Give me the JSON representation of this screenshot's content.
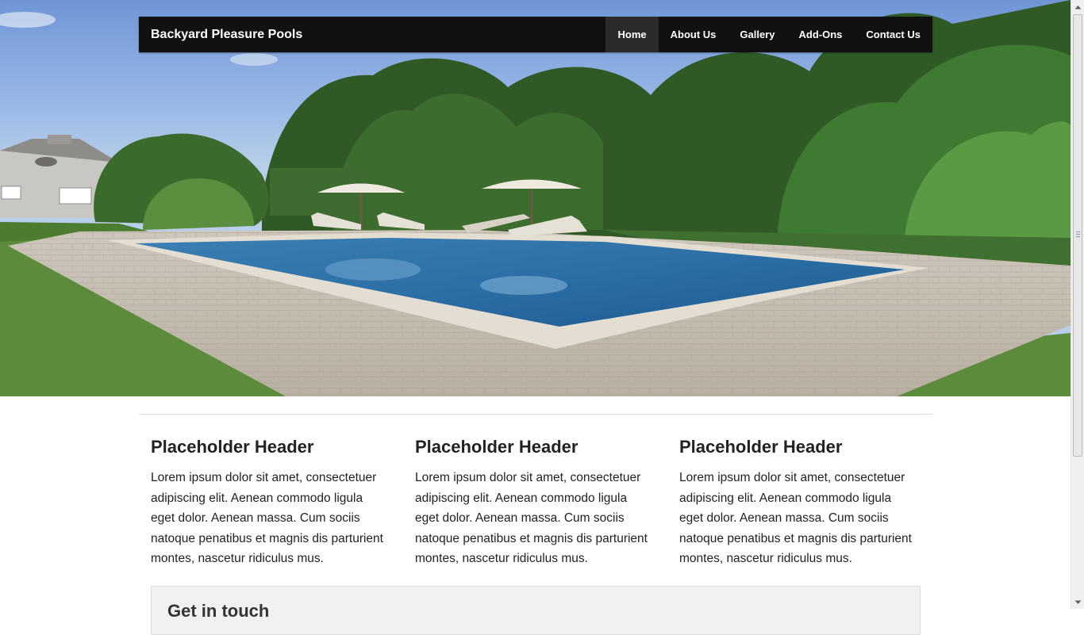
{
  "navbar": {
    "brand": "Backyard Pleasure Pools",
    "items": [
      {
        "label": "Home",
        "active": true
      },
      {
        "label": "About Us",
        "active": false
      },
      {
        "label": "Gallery",
        "active": false
      },
      {
        "label": "Add-Ons",
        "active": false
      },
      {
        "label": "Contact Us",
        "active": false
      }
    ]
  },
  "hero": {
    "icon": "pool-backyard-photo"
  },
  "columns": [
    {
      "heading": "Placeholder Header",
      "text": "Lorem ipsum dolor sit amet, consectetuer adipiscing elit. Aenean commodo ligula eget dolor. Aenean massa. Cum sociis natoque penatibus et magnis dis parturient montes, nascetur ridiculus mus."
    },
    {
      "heading": "Placeholder Header",
      "text": "Lorem ipsum dolor sit amet, consectetuer adipiscing elit. Aenean commodo ligula eget dolor. Aenean massa. Cum sociis natoque penatibus et magnis dis parturient montes, nascetur ridiculus mus."
    },
    {
      "heading": "Placeholder Header",
      "text": "Lorem ipsum dolor sit amet, consectetuer adipiscing elit. Aenean commodo ligula eget dolor. Aenean massa. Cum sociis natoque penatibus et magnis dis parturient montes, nascetur ridiculus mus."
    }
  ],
  "cta": {
    "heading": "Get in touch"
  },
  "colors": {
    "navbar": "#111111",
    "nav_active": "#2b2b2b",
    "text": "#222222"
  }
}
